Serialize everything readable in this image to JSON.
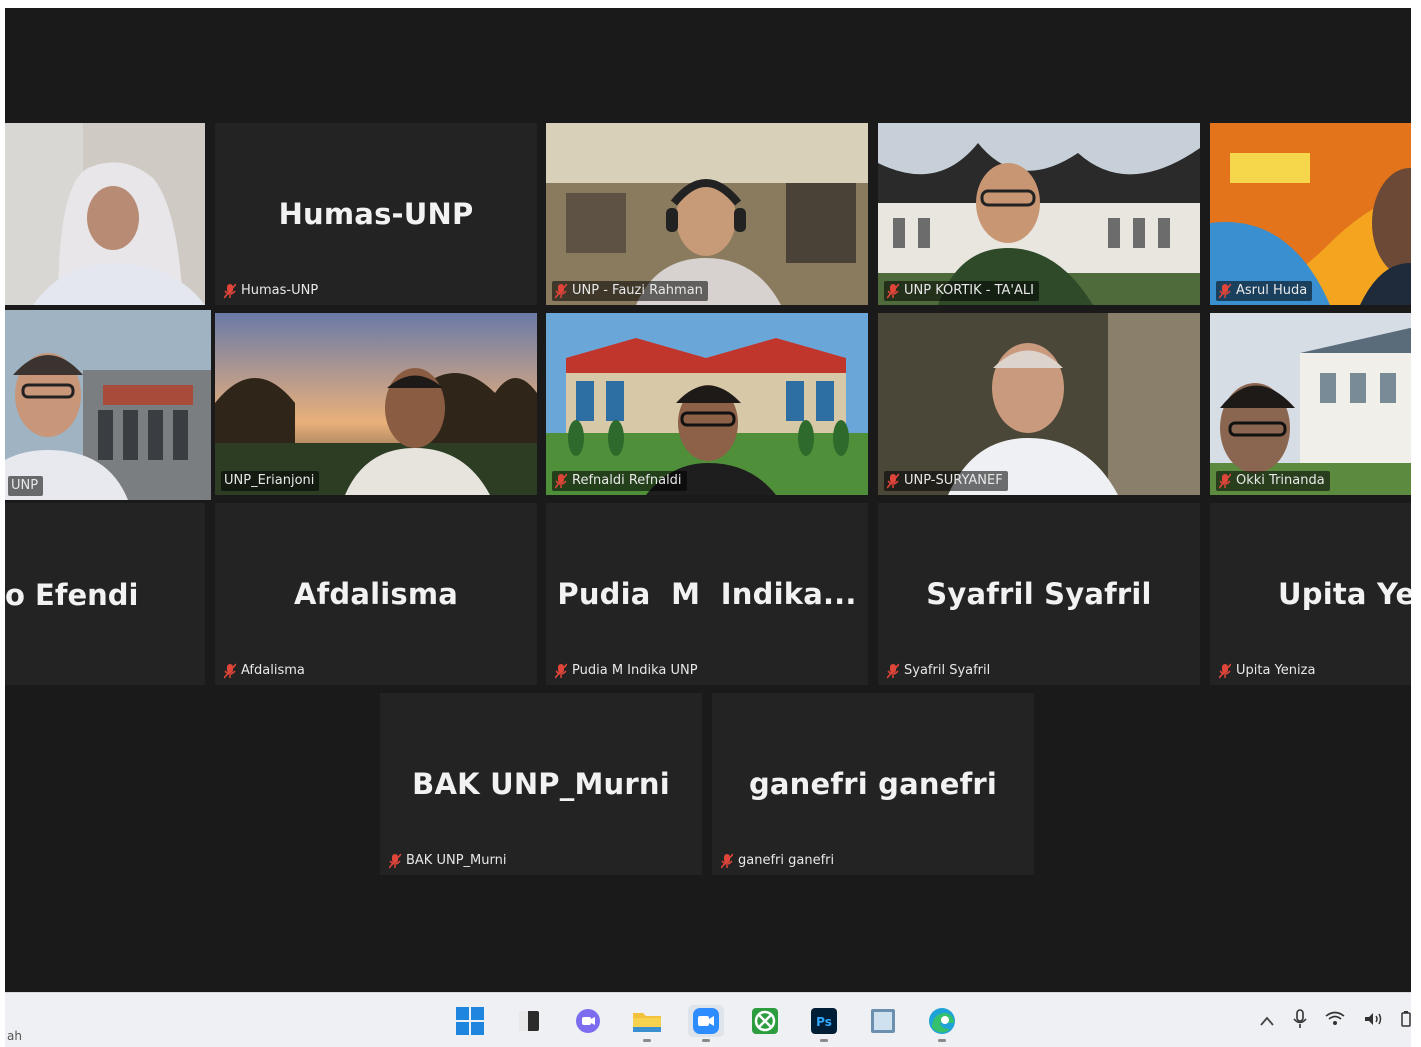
{
  "meeting": {
    "tiles": [
      {
        "id": "t1",
        "center": "",
        "label": ""
      },
      {
        "id": "t2",
        "center": "Humas-UNP",
        "label": "Humas-UNP"
      },
      {
        "id": "t3",
        "center": "",
        "label": "UNP - Fauzi Rahman"
      },
      {
        "id": "t4",
        "center": "",
        "label": "UNP KORTIK - TA'ALI"
      },
      {
        "id": "t5",
        "center": "",
        "label": "Asrul Huda"
      },
      {
        "id": "t6",
        "center": "",
        "label": "UNP"
      },
      {
        "id": "t7",
        "center": "",
        "label": "UNP_Erianjoni"
      },
      {
        "id": "t8",
        "center": "",
        "label": "Refnaldi Refnaldi"
      },
      {
        "id": "t9",
        "center": "",
        "label": "UNP-SURYANEF"
      },
      {
        "id": "t10",
        "center": "",
        "label": "Okki Trinanda"
      },
      {
        "id": "t11",
        "center": "o Efendi",
        "label": ""
      },
      {
        "id": "t12",
        "center": "Afdalisma",
        "label": "Afdalisma"
      },
      {
        "id": "t13",
        "center": "Pudia  M  Indika...",
        "label": "Pudia M Indika UNP"
      },
      {
        "id": "t14",
        "center": "Syafril Syafril",
        "label": "Syafril Syafril"
      },
      {
        "id": "t15",
        "center": "Upita Yer",
        "label": "Upita Yeniza"
      },
      {
        "id": "t16",
        "center": "BAK UNP_Murni",
        "label": "BAK UNP_Murni"
      },
      {
        "id": "t17",
        "center": "ganefri ganefri",
        "label": "ganefri ganefri"
      }
    ]
  },
  "taskbar": {
    "left_text": "ah",
    "apps": [
      "windows-start-icon",
      "file-explorer-icon",
      "chat-icon",
      "folder-icon",
      "zoom-icon",
      "xbox-icon",
      "photoshop-icon",
      "notepad-icon",
      "edge-icon"
    ],
    "photoshop_text": "Ps",
    "tray": [
      "chevron-up-icon",
      "microphone-icon",
      "wifi-icon",
      "volume-icon",
      "battery-icon"
    ]
  },
  "colors": {
    "active_speaker": "#d7e24a",
    "muted_mic": "#e0453a",
    "tile_bg": "#232323",
    "stage_bg": "#1a1a1a"
  }
}
